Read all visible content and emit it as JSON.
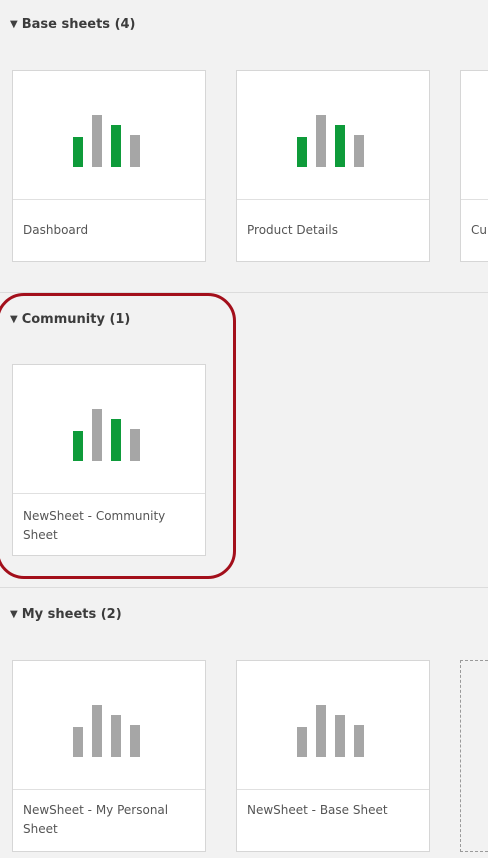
{
  "colors": {
    "accent_green": "#0e9b3a",
    "bar_gray": "#a6a6a6",
    "highlight_red": "#a30f1b"
  },
  "sections": [
    {
      "label": "Base sheets (4)",
      "caret_icon": "caret-down-icon",
      "sheets": [
        {
          "title": "Dashboard",
          "thumbnail": "bar-chart-icon"
        },
        {
          "title": "Product Details",
          "thumbnail": "bar-chart-icon"
        },
        {
          "title": "Cu",
          "thumbnail": "bar-chart-icon"
        }
      ]
    },
    {
      "label": "Community (1)",
      "caret_icon": "caret-down-icon",
      "sheets": [
        {
          "title": "NewSheet - Community Sheet",
          "thumbnail": "bar-chart-icon"
        }
      ]
    },
    {
      "label": "My sheets (2)",
      "caret_icon": "caret-down-icon",
      "sheets": [
        {
          "title": "NewSheet - My Personal Sheet",
          "thumbnail": "bar-chart-icon"
        },
        {
          "title": "NewSheet - Base Sheet",
          "thumbnail": "bar-chart-icon"
        }
      ],
      "create_placeholder_icon": "add-sheet-icon"
    }
  ]
}
